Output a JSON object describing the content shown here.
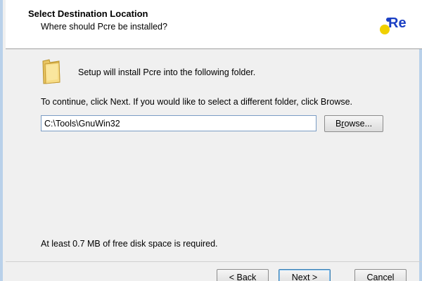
{
  "header": {
    "title": "Select Destination Location",
    "subtitle": "Where should Pcre be installed?",
    "logo_text": "Re"
  },
  "content": {
    "intro": "Setup will install Pcre into the following folder.",
    "instruction": "To continue, click Next. If you would like to select a different folder, click Browse.",
    "path_value": "C:\\Tools\\GnuWin32",
    "browse_prefix": "B",
    "browse_accel": "r",
    "browse_suffix": "owse...",
    "disk_space": "At least 0.7 MB of free disk space is required."
  },
  "footer": {
    "back_label": "< Back",
    "next_label": "Next >",
    "cancel_label": "Cancel"
  },
  "colors": {
    "frame": "#b9d1ea",
    "logo_blue": "#1a3fc4",
    "logo_yellow": "#f0d000"
  }
}
